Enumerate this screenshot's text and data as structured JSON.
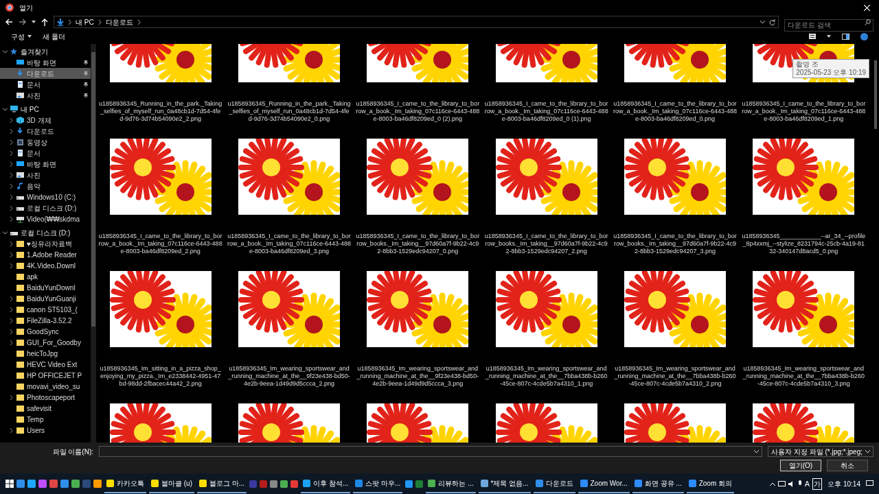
{
  "window": {
    "title": "열기"
  },
  "address": {
    "crumbs": [
      "내 PC",
      "다운로드"
    ]
  },
  "search": {
    "placeholder": "다운로드 검색"
  },
  "toolbar": {
    "organize": "구성",
    "new_folder": "새 폴더"
  },
  "sidebar": {
    "items": [
      {
        "label": "즐겨찾기",
        "kind": "star",
        "expanded": true,
        "selected": false,
        "children": [
          {
            "label": "바탕 화면",
            "kind": "desktop",
            "selected": false,
            "pinned": true
          },
          {
            "label": "다운로드",
            "kind": "download",
            "selected": true,
            "pinned": true
          },
          {
            "label": "문서",
            "kind": "document",
            "selected": false,
            "pinned": true
          },
          {
            "label": "사진",
            "kind": "picture",
            "selected": false,
            "pinned": true
          }
        ]
      },
      {
        "label": "내 PC",
        "kind": "pc",
        "expanded": true,
        "selected": false,
        "children": [
          {
            "label": "3D 개체",
            "kind": "cube",
            "expanded": false,
            "selected": false
          },
          {
            "label": "다운로드",
            "kind": "download",
            "expanded": false,
            "selected": false
          },
          {
            "label": "동영상",
            "kind": "video",
            "expanded": false,
            "selected": false
          },
          {
            "label": "문서",
            "kind": "document",
            "expanded": false,
            "selected": false
          },
          {
            "label": "바탕 화면",
            "kind": "desktop",
            "expanded": false,
            "selected": false
          },
          {
            "label": "사진",
            "kind": "picture",
            "expanded": false,
            "selected": false
          },
          {
            "label": "음악",
            "kind": "music",
            "expanded": false,
            "selected": false
          },
          {
            "label": "Windows10 (C:)",
            "kind": "drive",
            "expanded": false,
            "selected": false
          },
          {
            "label": "로컬 디스크 (D:)",
            "kind": "drive",
            "expanded": false,
            "selected": false
          },
          {
            "label": "Video(₩₩skdma",
            "kind": "netdrive",
            "expanded": false,
            "selected": false
          }
        ]
      },
      {
        "label": "로컬 디스크 (D:)",
        "kind": "drive",
        "expanded": true,
        "selected": false,
        "children": [
          {
            "label": "♥정유라자료백",
            "kind": "folder",
            "expanded": false,
            "selected": false
          },
          {
            "label": "1.Adobe Reader",
            "kind": "folder",
            "expanded": false,
            "selected": false
          },
          {
            "label": "4K.Video.Downl",
            "kind": "folder",
            "expanded": false,
            "selected": false
          },
          {
            "label": "apk",
            "kind": "folder",
            "selected": false
          },
          {
            "label": "BaiduYunDownl",
            "kind": "folder",
            "selected": false
          },
          {
            "label": "BaiduYunGuanji",
            "kind": "folder",
            "expanded": false,
            "selected": false
          },
          {
            "label": "canon ST5103_(",
            "kind": "folder",
            "expanded": false,
            "selected": false
          },
          {
            "label": "FileZilla-3.52.2",
            "kind": "folder",
            "expanded": false,
            "selected": false
          },
          {
            "label": "GoodSync",
            "kind": "folder",
            "expanded": false,
            "selected": false
          },
          {
            "label": "GUI_For_Goodby",
            "kind": "folder",
            "expanded": false,
            "selected": false
          },
          {
            "label": "heicToJpg",
            "kind": "folder",
            "selected": false
          },
          {
            "label": "HEVC Video Ext",
            "kind": "folder",
            "selected": false
          },
          {
            "label": "HP OFFICEJET P",
            "kind": "folder",
            "selected": false
          },
          {
            "label": "movavi_video_su",
            "kind": "folder",
            "selected": false
          },
          {
            "label": "Photoscapeport",
            "kind": "folder",
            "expanded": false,
            "selected": false
          },
          {
            "label": "safevisit",
            "kind": "folder",
            "selected": false
          },
          {
            "label": "Temp",
            "kind": "folder",
            "selected": false
          },
          {
            "label": "Users",
            "kind": "folder",
            "expanded": false,
            "selected": false
          }
        ]
      }
    ]
  },
  "files": [
    {
      "kind": "file",
      "name": "u1858936345_Running_in_the_park._Taking_selfies_of_myself_run_0a48cb1d-7d54-4fed-9d76-3d74b54090e2_2.png"
    },
    {
      "kind": "file",
      "name": "u1858936345_Running_in_the_park._Taking_selfies_of_myself_run_0a48cb1d-7d54-4fed-9d76-3d74b54090e2_0.png"
    },
    {
      "kind": "file",
      "name": "u1858936345_I_came_to_the_library_to_borrow_a_book._Im_taking_07c116ce-6443-488e-8003-ba46df8209ed_0 (2).png"
    },
    {
      "kind": "file",
      "name": "u1858936345_I_came_to_the_library_to_borrow_a_book._Im_taking_07c116ce-6443-488e-8003-ba46df8209ed_0 (1).png"
    },
    {
      "kind": "file",
      "name": "u1858936345_I_came_to_the_library_to_borrow_a_book._Im_taking_07c116ce-6443-488e-8003-ba46df8209ed_0.png"
    },
    {
      "kind": "file",
      "name": "u1858936345_I_came_to_the_library_to_borrow_a_book._Im_taking_07c116ce-6443-488e-8003-ba46df8209ed_1.png"
    },
    {
      "kind": "file",
      "name": "u1858936345_I_came_to_the_library_to_borrow_a_book._Im_taking_07c116ce-6443-488e-8003-ba46df8209ed_2.png"
    },
    {
      "kind": "file",
      "name": "u1858936345_I_came_to_the_library_to_borrow_a_book._Im_taking_07c116ce-6443-488e-8003-ba46df8209ed_3.png"
    },
    {
      "kind": "file",
      "name": "u1858936345_I_came_to_the_library_to_borrow_books._Im_taking__97d60a7f-9b22-4c92-8bb3-1529edc94207_0.png"
    },
    {
      "kind": "file",
      "name": "u1858936345_I_came_to_the_library_to_borrow_books._Im_taking__97d60a7f-9b22-4c92-8bb3-1529edc94207_2.png"
    },
    {
      "kind": "file",
      "name": "u1858936345_I_came_to_the_library_to_borrow_books._Im_taking__97d60a7f-9b22-4c92-8bb3-1529edc94207_3.png"
    },
    {
      "kind": "file",
      "name": "u1858936345____________--ar_34_--profile_8p4xxmj_--stylize_8231794c-25cb-4a19-8132-340147d8acd5_0.png"
    },
    {
      "kind": "file",
      "name": "u1858936345_Im_sitting_in_a_pizza_shop_enjoying_my_pizza._Im_e2338442-4951-47bd-98dd-2fbacec44a42_2.png"
    },
    {
      "kind": "file",
      "name": "u1858936345_Im_wearing_sportswear_and_running_machine_at_the__9f23e438-bd50-4e2b-9eea-1d49d9d5ccca_2.png"
    },
    {
      "kind": "file",
      "name": "u1858936345_Im_wearing_sportswear_and_running_machine_at_the__9f23e438-bd50-4e2b-9eea-1d49d9d5ccca_3.png"
    },
    {
      "kind": "file",
      "name": "u1858936345_Im_wearing_sportswear_and_running_machine_at_the__7bba438b-b260-45ce-807c-4cde5b7a4310_1.png"
    },
    {
      "kind": "file",
      "name": "u1858936345_Im_wearing_sportswear_and_running_machine_at_the__7bba438b-b260-45ce-807c-4cde5b7a4310_2.png"
    },
    {
      "kind": "file",
      "name": "u1858936345_Im_wearing_sportswear_and_running_machine_at_the__7bba438b-b260-45ce-807c-4cde5b7a4310_3.png"
    },
    {
      "kind": "thumbnail"
    },
    {
      "kind": "thumbnail"
    },
    {
      "kind": "thumbnail"
    },
    {
      "kind": "thumbnail"
    },
    {
      "kind": "thumbnail"
    },
    {
      "kind": "thumbnail"
    }
  ],
  "tooltip": {
    "lines": [
      "촬영 조",
      "2025-05-23 오후 10:19"
    ]
  },
  "footer": {
    "filename_label": "파일 이름(N):",
    "filetype": "사용자 지정 파일 (*.jpg;*.jpeg;",
    "open": "열기(O)",
    "cancel": "취소"
  },
  "taskbar": {
    "apps": [
      {
        "kind": "kakao",
        "label": "카카오톡"
      },
      {
        "kind": "kakao",
        "label": "블마클 (u)"
      },
      {
        "kind": "kakao",
        "label": "블로그 마..."
      },
      {
        "kind": "bird",
        "label": "이후 참석..."
      },
      {
        "kind": "blue",
        "label": "스팟 마우..."
      },
      {
        "kind": "chrome",
        "label": "리뷰하는 ..."
      },
      {
        "kind": "note",
        "label": "*제목 없음..."
      },
      {
        "kind": "download",
        "label": "다운로드"
      },
      {
        "kind": "zoom",
        "label": "Zoom Wor..."
      },
      {
        "kind": "zoom",
        "label": "화면 공유 ..."
      },
      {
        "kind": "zoom",
        "label": "Zoom 회의"
      }
    ],
    "ime": "A",
    "ime2": "가",
    "clock": "오후 10:14"
  }
}
